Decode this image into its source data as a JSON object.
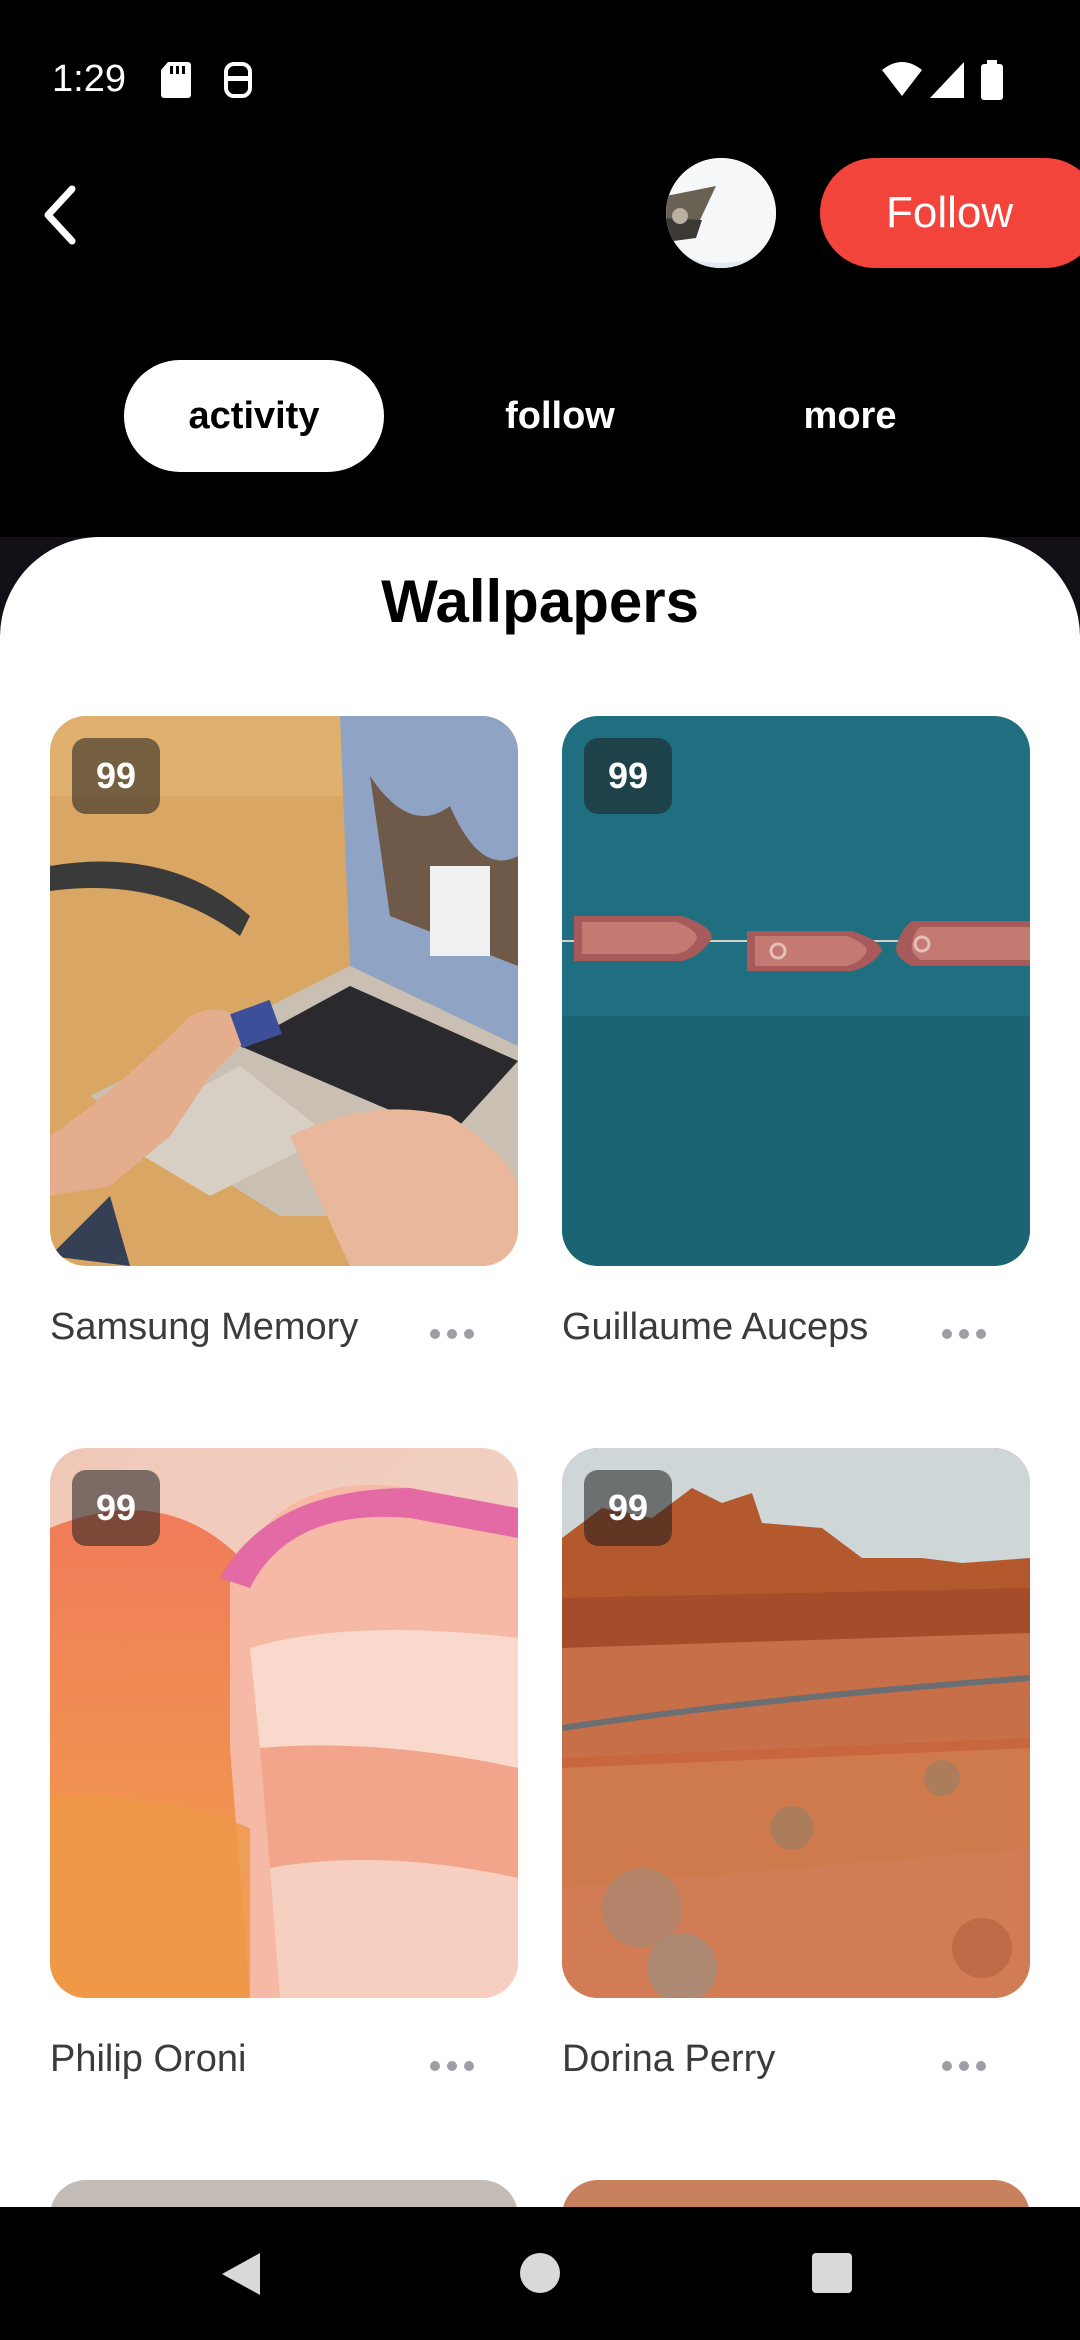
{
  "status": {
    "time": "1:29",
    "icons": [
      "sd-card-icon",
      "keyboard-icon",
      "wifi-icon",
      "signal-icon",
      "battery-icon"
    ]
  },
  "header": {
    "back_icon": "chevron-left-icon",
    "follow_label": "Follow",
    "accent": "#f2443a"
  },
  "tabs": [
    {
      "label": "activity",
      "active": true
    },
    {
      "label": "follow",
      "active": false
    },
    {
      "label": "more",
      "active": false
    }
  ],
  "section": {
    "title": "Wallpapers"
  },
  "cards": [
    {
      "name": "Samsung Memory",
      "count": "99"
    },
    {
      "name": "Guillaume Auceps",
      "count": "99"
    },
    {
      "name": "Philip Oroni",
      "count": "99"
    },
    {
      "name": "Dorina Perry",
      "count": "99"
    }
  ],
  "nav": {
    "icons": [
      "back-triangle-icon",
      "home-circle-icon",
      "recents-square-icon"
    ]
  }
}
